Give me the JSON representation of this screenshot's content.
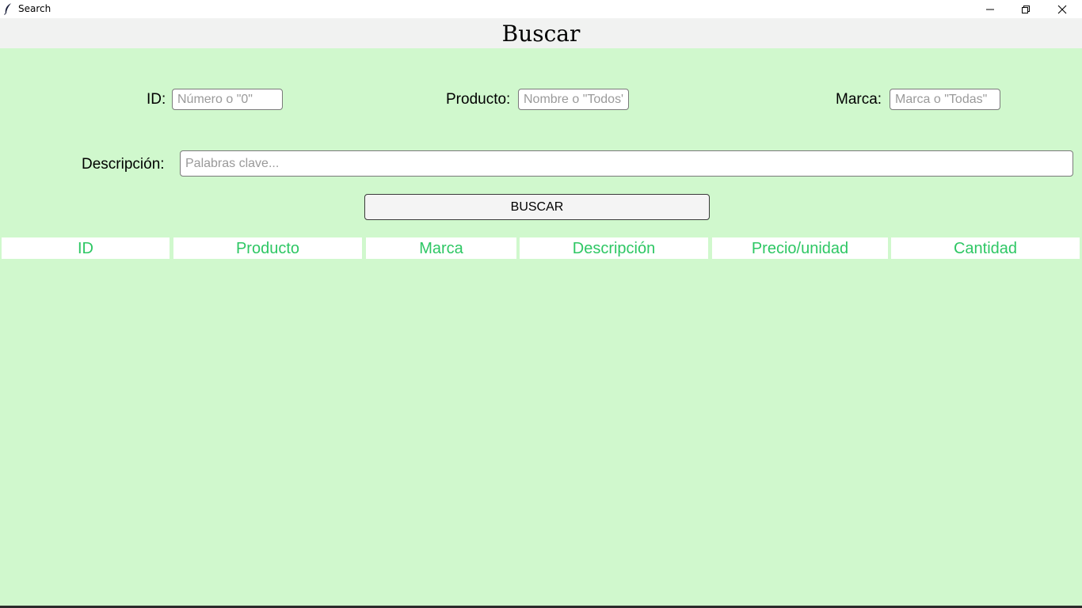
{
  "window": {
    "title": "Search",
    "controls": {
      "minimize": "minimize-icon",
      "maximize": "restore-icon",
      "close": "close-icon"
    }
  },
  "header": {
    "title": "Buscar"
  },
  "form": {
    "id_label": "ID:",
    "id_placeholder": "Número o \"0\"",
    "producto_label": "Producto:",
    "producto_placeholder": "Nombre o \"Todos\"",
    "marca_label": "Marca:",
    "marca_placeholder": "Marca o \"Todas\"",
    "descripcion_label": "Descripción:",
    "descripcion_placeholder": "Palabras clave...",
    "search_button": "BUSCAR"
  },
  "table": {
    "columns": [
      "ID",
      "Producto",
      "Marca",
      "Descripción",
      "Precio/unidad",
      "Cantidad"
    ]
  },
  "colors": {
    "background": "#d0f8cd",
    "header_band": "#f1f2f1",
    "column_header_text": "#2ec764"
  }
}
